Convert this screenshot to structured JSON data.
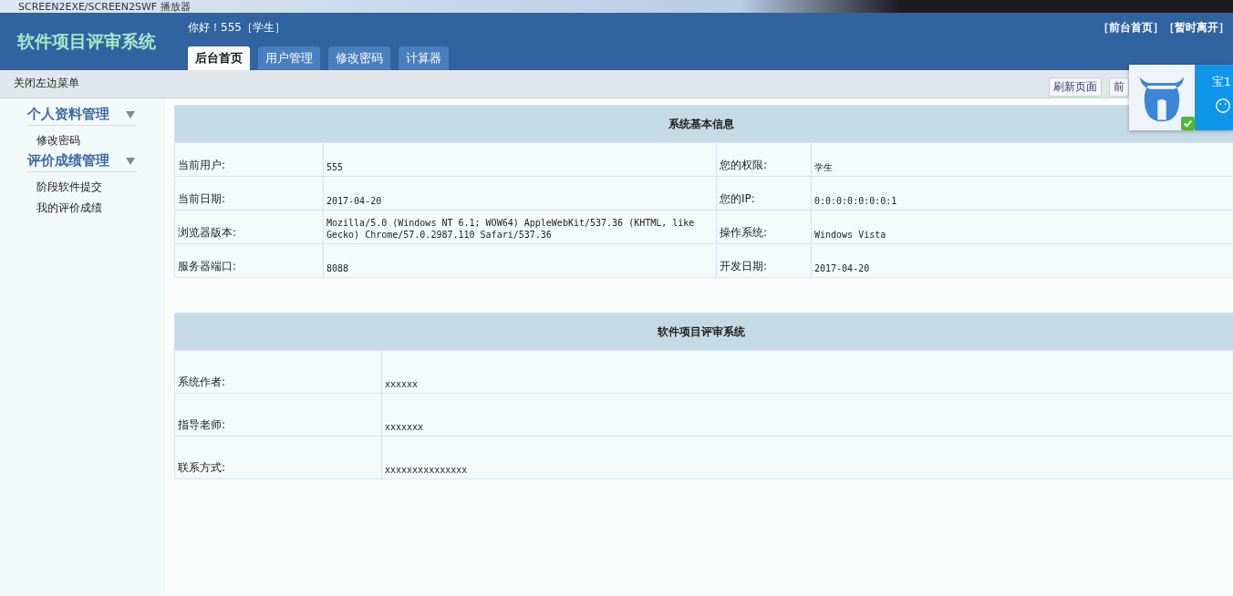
{
  "player_title": "SCREEN2EXE/SCREEN2SWF 播放器",
  "header": {
    "title": "软件项目评审系统",
    "greeting": "你好！555［学生］",
    "links": [
      "［前台首页］",
      "［暂时离开］"
    ]
  },
  "tabs": [
    {
      "label": "后台首页",
      "selected": true
    },
    {
      "label": "用户管理",
      "selected": false
    },
    {
      "label": "修改密码",
      "selected": false
    },
    {
      "label": "计算器",
      "selected": false
    }
  ],
  "toolbar": {
    "toggle_menu": "关闭左边菜单",
    "buttons": [
      "刷新页面",
      "前"
    ]
  },
  "sidebar": {
    "groups": [
      {
        "label": "个人资料管理",
        "expanded": true,
        "items": [
          "修改密码"
        ]
      },
      {
        "label": "评价成绩管理",
        "expanded": true,
        "items": [
          "阶段软件提交",
          "我的评价成绩"
        ]
      }
    ]
  },
  "info_table": {
    "title": "系统基本信息",
    "rows": [
      [
        "当前用户:",
        "555",
        "您的权限:",
        "学生"
      ],
      [
        "当前日期:",
        "2017-04-20",
        "您的IP:",
        "0:0:0:0:0:0:0:1"
      ],
      [
        "浏览器版本:",
        "Mozilla/5.0 (Windows NT 6.1; WOW64) AppleWebKit/537.36 (KHTML, like Gecko) Chrome/57.0.2987.110 Safari/537.36",
        "操作系统:",
        "Windows Vista"
      ],
      [
        "服务器端口:",
        "8088",
        "开发日期:",
        "2017-04-20"
      ]
    ]
  },
  "about_table": {
    "title": "软件项目评审系统",
    "rows": [
      [
        "系统作者:",
        "xxxxxx"
      ],
      [
        "指导老师:",
        "xxxxxxx"
      ],
      [
        "联系方式:",
        "xxxxxxxxxxxxxxx"
      ]
    ]
  },
  "widget": {
    "text": "宝1"
  }
}
